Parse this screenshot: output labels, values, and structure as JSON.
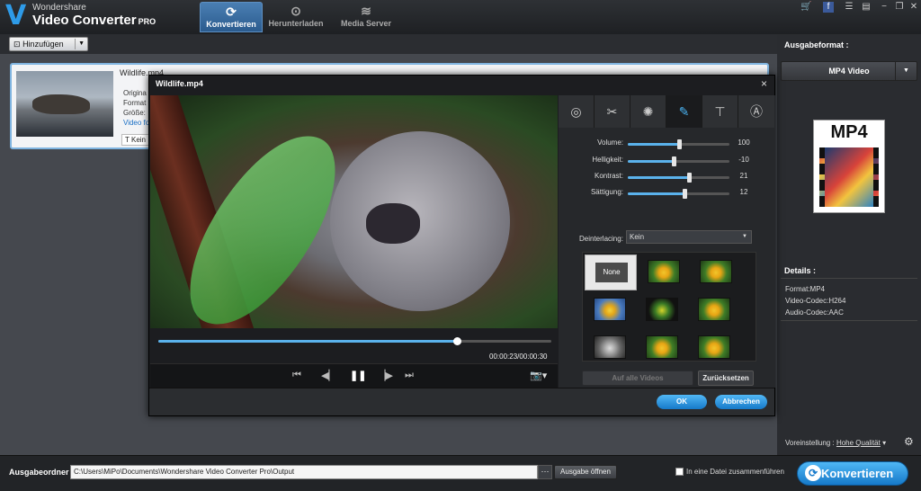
{
  "app": {
    "brand_small": "Wondershare",
    "brand_name": "Video Converter",
    "brand_edition": "PRO",
    "logo_letter": "V"
  },
  "nav": {
    "tabs": [
      {
        "label": "Konvertieren",
        "icon": "convert-icon",
        "active": true
      },
      {
        "label": "Herunterladen",
        "icon": "download-icon",
        "active": false
      },
      {
        "label": "Media Server",
        "icon": "wifi-icon",
        "active": false
      }
    ]
  },
  "toolbar": {
    "add_label": "Hinzufügen"
  },
  "file": {
    "name": "Wildlife.mp4",
    "info_lines": [
      "Origina",
      "Format",
      "Größe:",
      "Video fo"
    ],
    "subtitle_button": "Kein"
  },
  "output_panel": {
    "label": "Ausgabeformat :",
    "selected_format": "MP4 Video",
    "format_icon_label": "MP4",
    "details_label": "Details :",
    "details": [
      "Format:MP4",
      "Video-Codec:H264",
      "Audio-Codec:AAC"
    ],
    "preset_label": "Voreinstellung :",
    "preset_value": "Hohe Qualität"
  },
  "bottom": {
    "output_label": "Ausgabeordner",
    "output_path": "C:\\Users\\MiPo\\Documents\\Wondershare Video Converter Pro\\Output",
    "browse_label": "···",
    "open_label": "Ausgabe öffnen",
    "merge_label": "In eine Datei zusammenführen",
    "convert_label": "Konvertieren"
  },
  "dialog": {
    "title": "Wildlife.mp4",
    "close_symbol": "×",
    "timecode": "00:00:23/00:00:30",
    "progress": 0.76,
    "effect_tabs": [
      "subtitle-icon",
      "scissors-icon",
      "brightness-icon",
      "magic-wand-icon",
      "crop-icon",
      "watermark-icon"
    ],
    "active_tab": 3,
    "sliders": [
      {
        "label": "Volume:",
        "value": "100",
        "position": 0.5
      },
      {
        "label": "Helligkeit:",
        "value": "-10",
        "position": 0.45
      },
      {
        "label": "Kontrast:",
        "value": "21",
        "position": 0.6
      },
      {
        "label": "Sättigung:",
        "value": "12",
        "position": 0.56
      }
    ],
    "deinterlacing_label": "Deinterlacing:",
    "deinterlacing_value": "Kein",
    "effect_none_label": "None",
    "apply_all_label": "Auf alle Videos",
    "reset_label": "Zurücksetzen",
    "ok_label": "OK",
    "cancel_label": "Abbrechen"
  },
  "colors": {
    "accent": "#2e9be8",
    "button_blue": "#1679c9",
    "panel_dark": "#2a2c30"
  }
}
